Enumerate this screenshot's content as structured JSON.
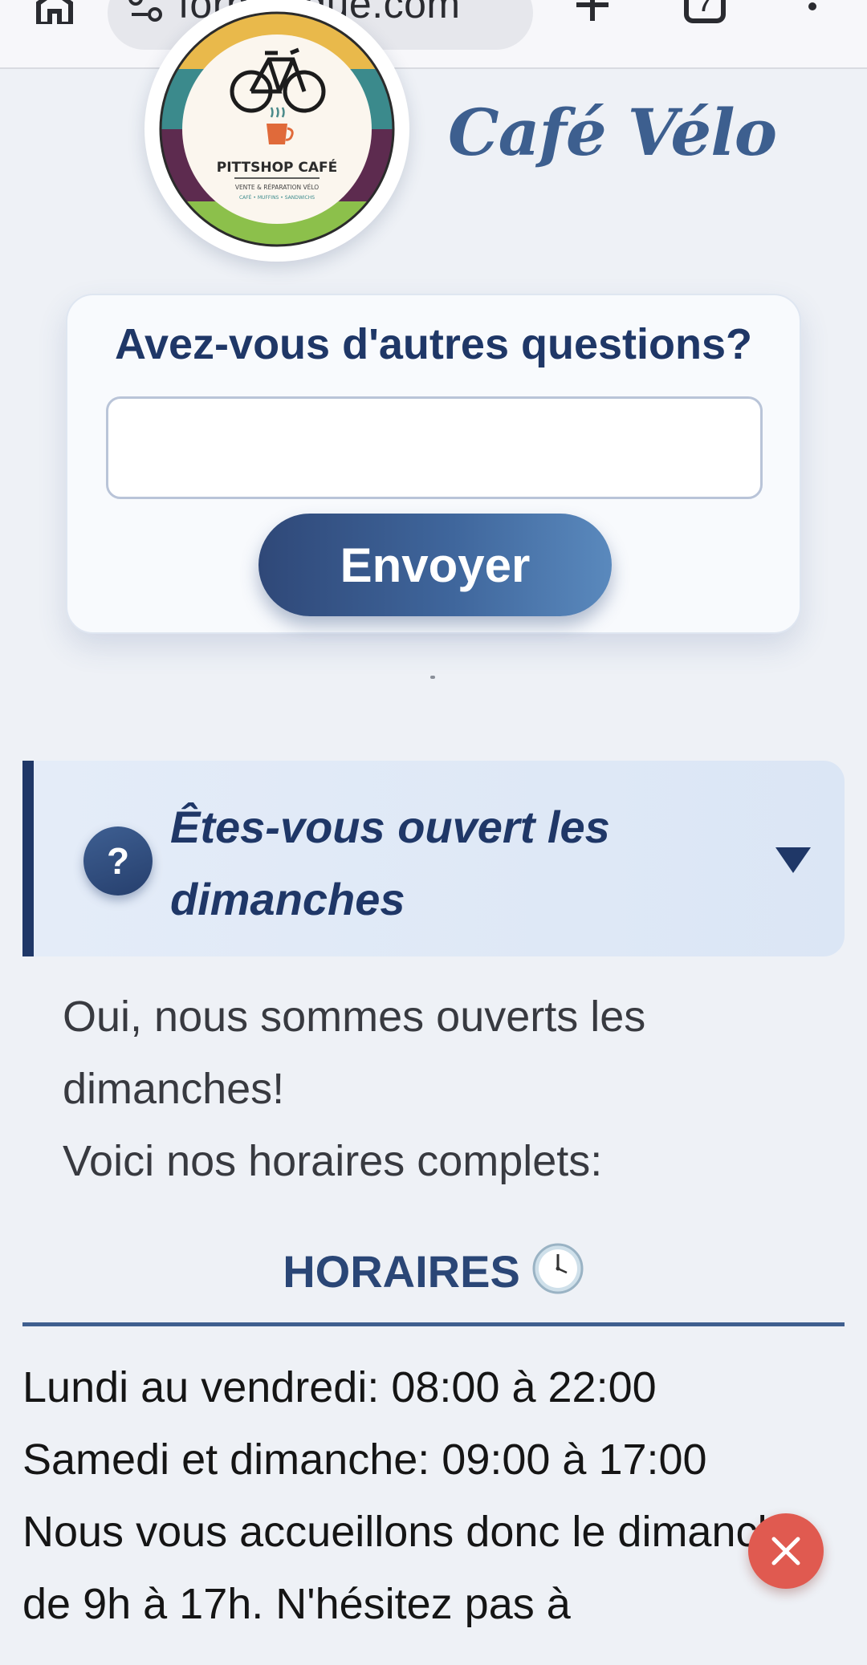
{
  "browser": {
    "url_text": "formatique.com",
    "tab_count": "7"
  },
  "header": {
    "brand_name": "Café Vélo",
    "logo": {
      "name": "PITTSHOP CAFÉ",
      "tagline": "VENTE & RÉPARATION VÉLO",
      "subtagline": "CAFÉ • MUFFINS • SANDWICHS"
    }
  },
  "question_form": {
    "title": "Avez-vous d'autres questions?",
    "input_value": "",
    "submit_label": "Envoyer"
  },
  "faq": {
    "question": "Êtes-vous ouvert les dimanches",
    "icon_label": "?",
    "answer_line1": "Oui, nous sommes ouverts les dimanches!",
    "answer_line2": "Voici nos horaires complets:"
  },
  "hours": {
    "title": "HORAIRES",
    "line1": "Lundi au vendredi: 08:00 à 22:00",
    "line2": "Samedi et dimanche: 09:00 à 17:00",
    "line3": "Nous vous accueillons donc le dimanche de 9h à 17h. N'hésitez pas à"
  },
  "colors": {
    "primary": "#1f3767",
    "accent": "#3d5f8f",
    "close": "#e05a50",
    "background": "#eef1f6"
  }
}
